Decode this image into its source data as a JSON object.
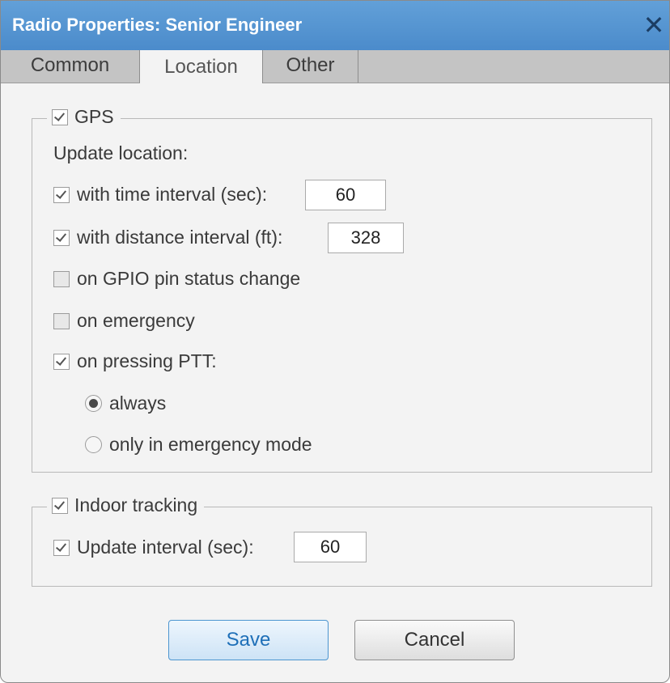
{
  "window": {
    "title": "Radio Properties: Senior Engineer",
    "close_glyph": "✕"
  },
  "tabs": [
    {
      "label": "Common",
      "active": false
    },
    {
      "label": "Location",
      "active": true
    },
    {
      "label": "Other",
      "active": false
    }
  ],
  "gps": {
    "label": "GPS",
    "checked": true,
    "update_location_label": "Update location:",
    "time_interval": {
      "label": "with time interval (sec):",
      "checked": true,
      "value": "60"
    },
    "distance_interval": {
      "label": "with distance interval (ft):",
      "checked": true,
      "value": "328"
    },
    "gpio": {
      "label": "on GPIO pin status change",
      "checked": false
    },
    "emergency": {
      "label": "on emergency",
      "checked": false
    },
    "ptt": {
      "label": "on pressing PTT:",
      "checked": true
    },
    "ptt_options": [
      {
        "label": "always",
        "selected": true
      },
      {
        "label": "only in emergency mode",
        "selected": false
      }
    ]
  },
  "indoor": {
    "label": "Indoor tracking",
    "checked": true,
    "update_interval": {
      "label": "Update interval (sec):",
      "checked": true,
      "value": "60"
    }
  },
  "buttons": {
    "save": "Save",
    "cancel": "Cancel"
  },
  "colors": {
    "titlebar": "#4f8fcd",
    "accent": "#1e6fb8"
  }
}
